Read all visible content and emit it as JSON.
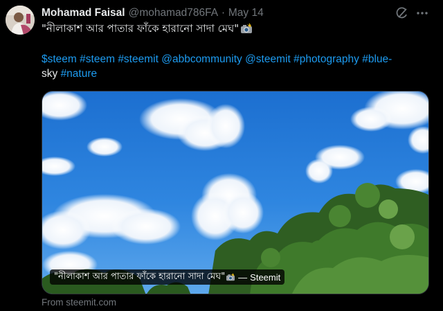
{
  "author": {
    "name": "Mohamad Faisal",
    "handle": "@mohamad786FA",
    "separator": "·",
    "date": "May 14"
  },
  "tweet": {
    "text": "\"নীলাকাশ আর পাতার ফাঁকে হারানো সাদা মেঘ\"",
    "hashtags_line1": [
      "$steem",
      "#steem",
      "#steemit",
      "@abbcommunity",
      "@steemit",
      "#photography",
      "#blue-"
    ],
    "hashtags_line2_tail": "sky",
    "hashtags_line2": [
      "#nature"
    ]
  },
  "card": {
    "caption_title": "\"নীলাকাশ আর পাতার ফাঁকে হারানো সাদা মেঘ\"",
    "caption_sep": "—",
    "caption_site": "Steemit",
    "from_text": "From steemit.com"
  },
  "icons": {
    "grok": "grok-icon",
    "more": "more-options-icon",
    "camera": "camera-flash-icon"
  },
  "colors": {
    "background": "#000000",
    "text": "#e7e9ea",
    "muted": "#71767b",
    "link": "#1d9bf0",
    "sky": "#2f86e0"
  }
}
